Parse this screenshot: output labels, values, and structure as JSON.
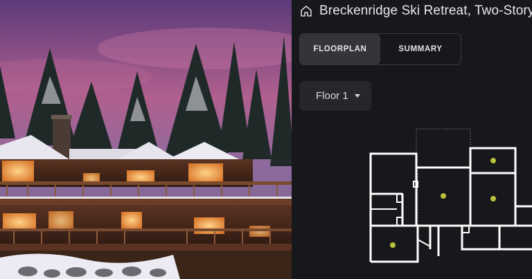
{
  "header": {
    "title": "Breckenridge Ski Retreat, Two-Story Log Cabin, Snowy Mountain Setting"
  },
  "tabs": [
    {
      "label": "FLOORPLAN",
      "active": true
    },
    {
      "label": "SUMMARY",
      "active": false
    }
  ],
  "floor_selector": {
    "value": "Floor 1"
  },
  "icons": {
    "home": "home-icon",
    "dropdown": "chevron-down-icon"
  },
  "colors": {
    "panel_bg": "#17181b",
    "tab_active": "#34353a",
    "room_marker": "#b9c23a",
    "wall": "#ffffff"
  }
}
